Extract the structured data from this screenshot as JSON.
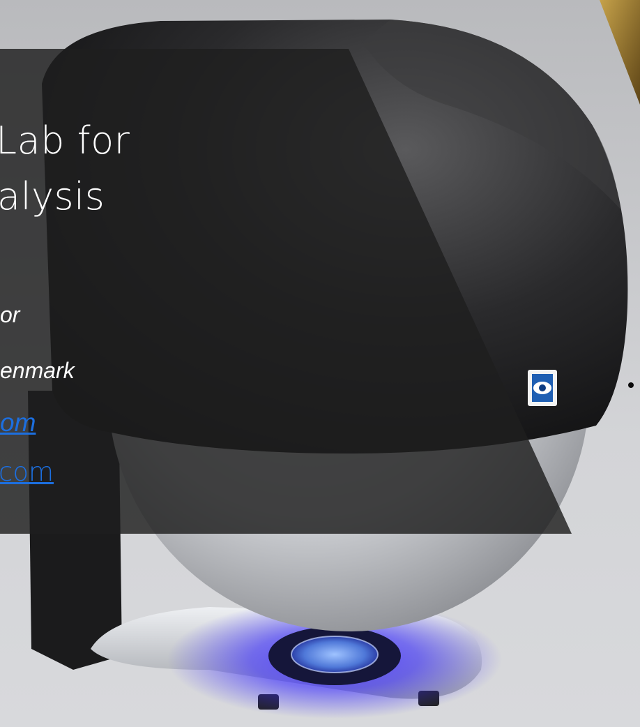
{
  "slide": {
    "title_line_1": "Lab for",
    "title_line_2": "alysis",
    "italic_line_1": "or",
    "italic_line_2": "enmark",
    "link_1": "om",
    "link_2": "com"
  },
  "colors": {
    "overlay": "#1f1f1f",
    "link": "#1c6fe0",
    "uv_glow": "#3a2cff",
    "background": "#c9cacd"
  },
  "icons": {
    "device_logo": "eye-logo-icon"
  }
}
